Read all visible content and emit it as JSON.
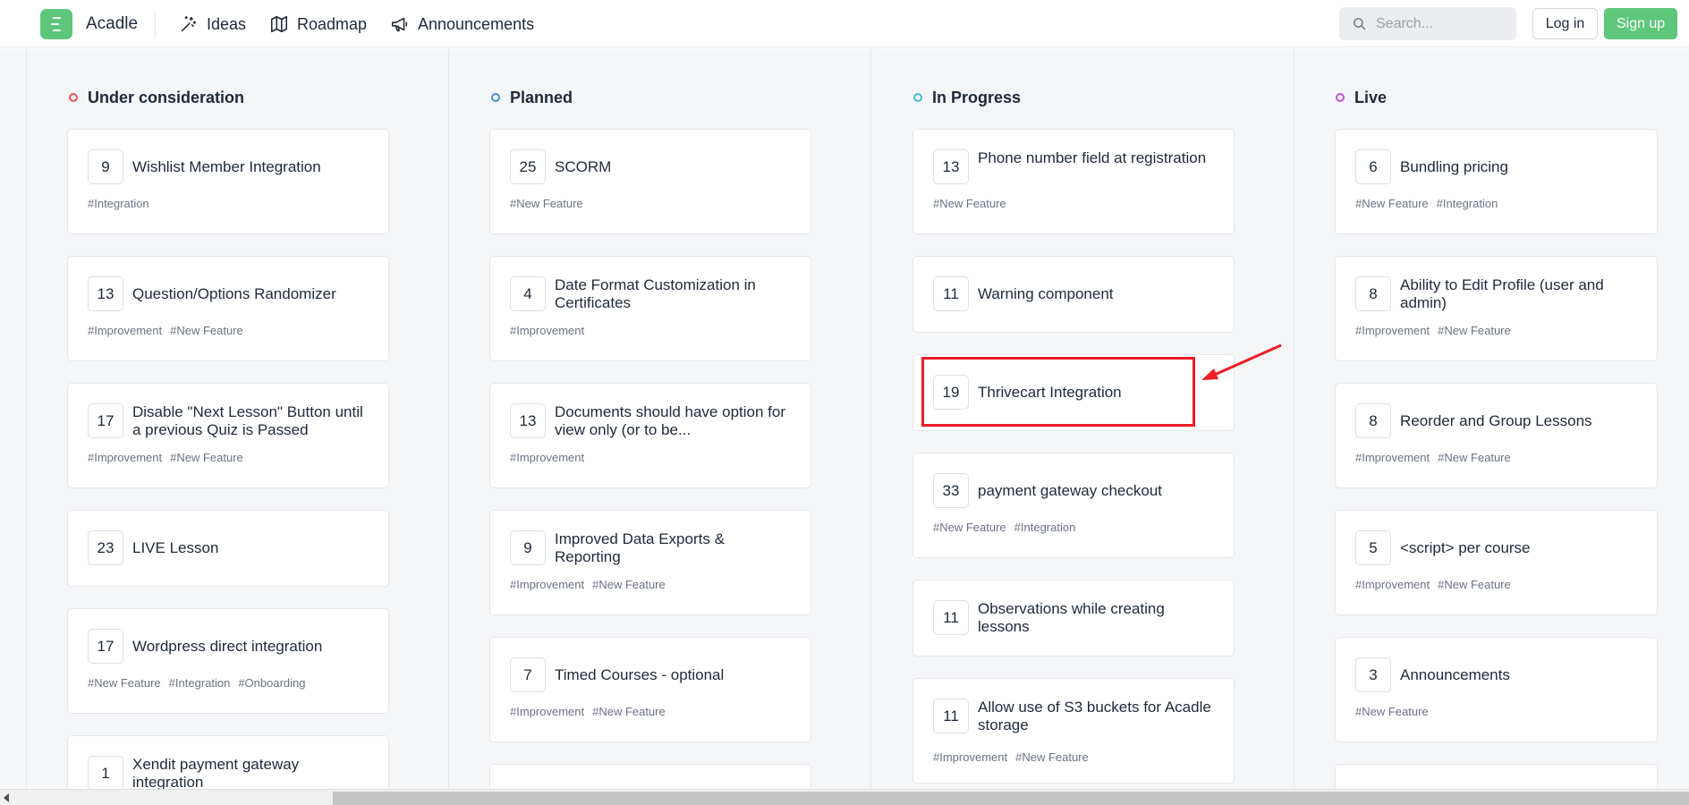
{
  "header": {
    "brand": "Acadle",
    "nav": [
      {
        "label": "Ideas",
        "icon": "magic-wand-icon"
      },
      {
        "label": "Roadmap",
        "icon": "map-icon"
      },
      {
        "label": "Announcements",
        "icon": "megaphone-icon"
      }
    ],
    "search_placeholder": "Search...",
    "login_label": "Log in",
    "signup_label": "Sign up"
  },
  "colors": {
    "brand_green": "#5ec77a",
    "under_consideration": "#f0525d",
    "planned": "#4a8fd0",
    "in_progress": "#3bbde0",
    "live": "#c455d6",
    "highlight": "#ef1c25"
  },
  "columns": [
    {
      "title": "Under consideration",
      "cards": [
        {
          "votes": "9",
          "title": "Wishlist Member Integration",
          "tags": [
            "#Integration"
          ]
        },
        {
          "votes": "13",
          "title": "Question/Options Randomizer",
          "tags": [
            "#Improvement",
            "#New Feature"
          ]
        },
        {
          "votes": "17",
          "title": "Disable \"Next Lesson\" Button until a previous Quiz is Passed",
          "tags": [
            "#Improvement",
            "#New Feature"
          ]
        },
        {
          "votes": "23",
          "title": "LIVE Lesson",
          "tags": []
        },
        {
          "votes": "17",
          "title": "Wordpress direct integration",
          "tags": [
            "#New Feature",
            "#Integration",
            "#Onboarding"
          ]
        },
        {
          "votes": "1",
          "title": "Xendit payment gateway integration",
          "tags": []
        }
      ]
    },
    {
      "title": "Planned",
      "cards": [
        {
          "votes": "25",
          "title": "SCORM",
          "tags": [
            "#New Feature"
          ]
        },
        {
          "votes": "4",
          "title": "Date Format Customization in Certificates",
          "tags": [
            "#Improvement"
          ]
        },
        {
          "votes": "13",
          "title": "Documents should have option for view only (or to be...",
          "tags": [
            "#Improvement"
          ]
        },
        {
          "votes": "9",
          "title": "Improved Data Exports & Reporting",
          "tags": [
            "#Improvement",
            "#New Feature"
          ]
        },
        {
          "votes": "7",
          "title": "Timed Courses - optional",
          "tags": [
            "#Improvement",
            "#New Feature"
          ]
        }
      ]
    },
    {
      "title": "In Progress",
      "cards": [
        {
          "votes": "13",
          "title": "Phone number field at registration",
          "tags": [
            "#New Feature"
          ]
        },
        {
          "votes": "11",
          "title": "Warning component",
          "tags": []
        },
        {
          "votes": "19",
          "title": "Thrivecart Integration",
          "tags": []
        },
        {
          "votes": "33",
          "title": "payment gateway checkout",
          "tags": [
            "#New Feature",
            "#Integration"
          ]
        },
        {
          "votes": "11",
          "title": "Observations while creating lessons",
          "tags": []
        },
        {
          "votes": "11",
          "title": "Allow use of S3 buckets for Acadle storage",
          "tags": [
            "#Improvement",
            "#New Feature"
          ]
        }
      ]
    },
    {
      "title": "Live",
      "cards": [
        {
          "votes": "6",
          "title": "Bundling pricing",
          "tags": [
            "#New Feature",
            "#Integration"
          ]
        },
        {
          "votes": "8",
          "title": "Ability to Edit Profile (user and admin)",
          "tags": [
            "#Improvement",
            "#New Feature"
          ]
        },
        {
          "votes": "8",
          "title": "Reorder and Group Lessons",
          "tags": [
            "#Improvement",
            "#New Feature"
          ]
        },
        {
          "votes": "5",
          "title": "<script> per course",
          "tags": [
            "#Improvement",
            "#New Feature"
          ]
        },
        {
          "votes": "3",
          "title": "Announcements",
          "tags": [
            "#New Feature"
          ]
        }
      ]
    }
  ]
}
